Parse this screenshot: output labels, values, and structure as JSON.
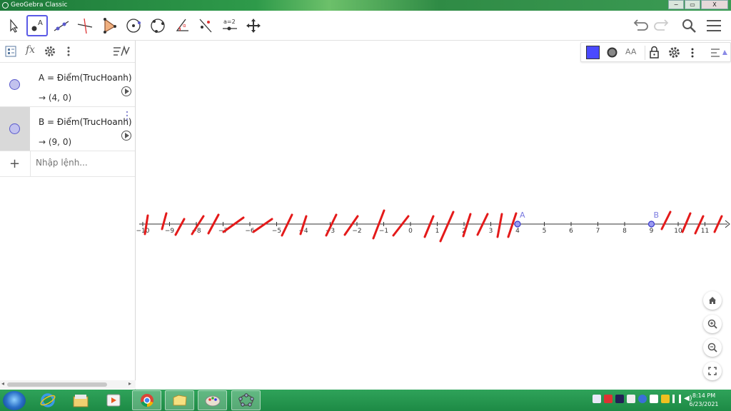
{
  "window": {
    "title": "GeoGebra Classic",
    "minimize": "−",
    "restore": "▭",
    "close": "X"
  },
  "toolbar": {
    "tools": [
      "move",
      "point",
      "line",
      "perpendicular-line",
      "polygon",
      "circle",
      "circle-through-points",
      "angle",
      "reflect",
      "slider",
      "move-graphics-view"
    ],
    "slider_label": "a=2",
    "point_label": "A",
    "right": [
      "undo",
      "redo",
      "search",
      "menu"
    ]
  },
  "algebra": {
    "header_icons": [
      "algebra-view-icon",
      "fx-icon",
      "settings-icon",
      "more-icon",
      "sort-icon"
    ],
    "items": [
      {
        "definition": "A = Điểm(TrucHoanh)",
        "value": "→  (4, 0)",
        "color": "#5a5acc"
      },
      {
        "definition": "B = Điểm(TrucHoanh)",
        "value": "→  (9, 0)",
        "color": "#5a5acc"
      }
    ],
    "input_placeholder": "Nhập lệnh..."
  },
  "graphics": {
    "axis_ticks": [
      "−10",
      "−9",
      "−8",
      "−7",
      "−6",
      "−5",
      "−4",
      "−3",
      "−2",
      "−1",
      "0",
      "1",
      "2",
      "3",
      "4",
      "5",
      "6",
      "7",
      "8",
      "9",
      "10",
      "11"
    ],
    "points": [
      {
        "label": "A",
        "x": 4
      },
      {
        "label": "B",
        "x": 9
      }
    ],
    "style_bar": {
      "color": "#4a4aff",
      "text_label": "AA"
    },
    "annotation_color": "#e41a1a"
  },
  "taskbar": {
    "apps": [
      "start",
      "internet-explorer",
      "file-explorer",
      "media-player",
      "chrome",
      "folder",
      "paint",
      "geogebra"
    ],
    "time": "8:14 PM",
    "date": "6/23/2021"
  }
}
